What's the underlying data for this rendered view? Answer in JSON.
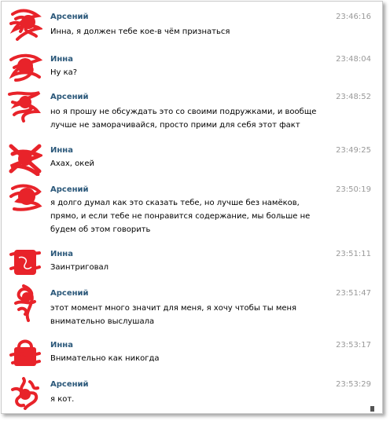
{
  "colors": {
    "name": "#2b587a",
    "time": "#999999",
    "avatar_scribble": "#e8232a",
    "row_shade": "#f3f5f8"
  },
  "messages": [
    {
      "author": "Арсений",
      "time": "23:46:16",
      "text": "Инна, я должен тебе кое-в чём признаться",
      "avatar": "scribbled-avatar"
    },
    {
      "author": "Инна",
      "time": "23:48:04",
      "text": "Ну ка?",
      "avatar": "scribbled-avatar"
    },
    {
      "author": "Арсений",
      "time": "23:48:52",
      "text": "но я прошу не обсуждать это со своими подружками, и вообще лучше не заморачивайся, просто прими для себя этот факт",
      "avatar": "scribbled-avatar"
    },
    {
      "author": "Инна",
      "time": "23:49:25",
      "text": "Ахах, окей",
      "avatar": "scribbled-avatar"
    },
    {
      "author": "Арсений",
      "time": "23:50:19",
      "text": "я долго думал как это сказать тебе, но лучше без намёков, прямо, и если тебе не понравится содержание, мы больше не будем об этом говорить",
      "avatar": "scribbled-avatar"
    },
    {
      "author": "Инна",
      "time": "23:51:11",
      "text": "Заинтриговал",
      "avatar": "scribbled-avatar"
    },
    {
      "author": "Арсений",
      "time": "23:51:47",
      "text": "этот момент много значит для меня, я хочу чтобы ты меня внимательно выслушала",
      "avatar": "scribbled-avatar"
    },
    {
      "author": "Инна",
      "time": "23:53:17",
      "text": "Внимательно как никогда",
      "avatar": "scribbled-avatar"
    },
    {
      "author": "Арсений",
      "time": "23:53:29",
      "text": "я кот.",
      "avatar": "scribbled-avatar"
    }
  ]
}
